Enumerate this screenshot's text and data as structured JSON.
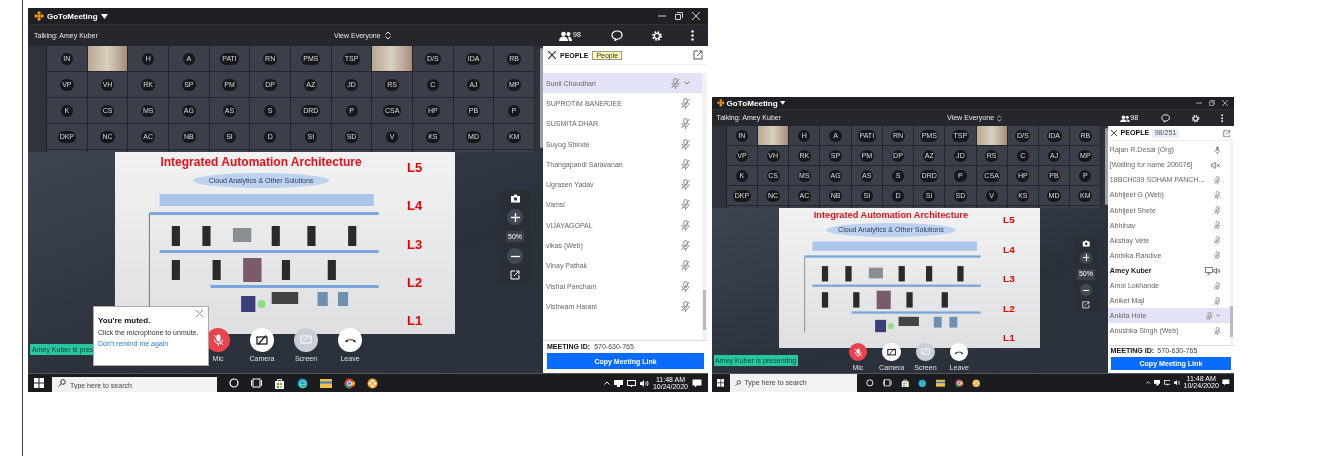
{
  "screenshots": [
    {
      "app_name": "GoToMeeting",
      "talking": "Talking: Amey Kuber",
      "view_selector": "View Everyone",
      "people_count": "98",
      "tiles": [
        {
          "kind": "initials",
          "text": "IN"
        },
        {
          "kind": "video"
        },
        {
          "kind": "initials",
          "text": "H"
        },
        {
          "kind": "initials",
          "text": "A"
        },
        {
          "kind": "initials",
          "text": "PATI"
        },
        {
          "kind": "initials",
          "text": "RN"
        },
        {
          "kind": "initials",
          "text": "PMS"
        },
        {
          "kind": "initials",
          "text": "TSP"
        },
        {
          "kind": "video"
        },
        {
          "kind": "initials",
          "text": "D/S"
        },
        {
          "kind": "initials",
          "text": "IDA"
        },
        {
          "kind": "initials",
          "text": "RB"
        },
        {
          "kind": "initials",
          "text": "VP"
        },
        {
          "kind": "initials",
          "text": "VH"
        },
        {
          "kind": "initials",
          "text": "RK"
        },
        {
          "kind": "initials",
          "text": "SP"
        },
        {
          "kind": "initials",
          "text": "PM"
        },
        {
          "kind": "initials",
          "text": "DP"
        },
        {
          "kind": "initials",
          "text": "AZ"
        },
        {
          "kind": "initials",
          "text": "JD"
        },
        {
          "kind": "initials",
          "text": "RS"
        },
        {
          "kind": "initials",
          "text": "C"
        },
        {
          "kind": "initials",
          "text": "AJ"
        },
        {
          "kind": "initials",
          "text": "MP"
        },
        {
          "kind": "initials",
          "text": "K"
        },
        {
          "kind": "initials",
          "text": "CS"
        },
        {
          "kind": "initials",
          "text": "MS"
        },
        {
          "kind": "initials",
          "text": "AG"
        },
        {
          "kind": "initials",
          "text": "AS"
        },
        {
          "kind": "initials",
          "text": "S"
        },
        {
          "kind": "initials",
          "text": "DRD"
        },
        {
          "kind": "initials",
          "text": "P"
        },
        {
          "kind": "initials",
          "text": "CSA"
        },
        {
          "kind": "initials",
          "text": "HP"
        },
        {
          "kind": "initials",
          "text": "PB"
        },
        {
          "kind": "initials",
          "text": "P"
        },
        {
          "kind": "initials",
          "text": "DKP"
        },
        {
          "kind": "initials",
          "text": "NC"
        },
        {
          "kind": "initials",
          "text": "AC"
        },
        {
          "kind": "initials",
          "text": "NB"
        },
        {
          "kind": "initials",
          "text": "SI"
        },
        {
          "kind": "initials",
          "text": "D"
        },
        {
          "kind": "initials",
          "text": "SI"
        },
        {
          "kind": "initials",
          "text": "SD"
        },
        {
          "kind": "initials",
          "text": "V"
        },
        {
          "kind": "initials",
          "text": "KS"
        },
        {
          "kind": "initials",
          "text": "MD"
        },
        {
          "kind": "initials",
          "text": "KM"
        }
      ],
      "slide": {
        "title": "Integrated Automation Architecture",
        "banner": "Cloud Analytics & Other Solutions",
        "levels": [
          "L5",
          "L4",
          "L3",
          "L2",
          "L1"
        ]
      },
      "zoom_level": "50%",
      "presenter_badge": "Amey Kuber is pres",
      "muted_popup": {
        "title": "You're muted.",
        "message": "Click the microphone to unmute.",
        "link": "Don't remind me again"
      },
      "controls": [
        {
          "kind": "mic",
          "label": "Mic",
          "disabled": false
        },
        {
          "kind": "camera",
          "label": "Camera",
          "disabled": false
        },
        {
          "kind": "screen",
          "label": "Screen",
          "disabled": true
        },
        {
          "kind": "leave",
          "label": "Leave",
          "disabled": false
        }
      ],
      "panel": {
        "title": "PEOPLE",
        "tooltip": "People"
      },
      "people": [
        {
          "name": "Sunil Choudhari",
          "kind": "mic_muted",
          "selected": true
        },
        {
          "name": "SUPROTIM BANERJEE",
          "kind": "mic_muted",
          "selected": false
        },
        {
          "name": "SUSMITA DHAR",
          "kind": "mic_muted",
          "selected": false
        },
        {
          "name": "Suyog Shinde",
          "kind": "mic_muted",
          "selected": false
        },
        {
          "name": "Thangapandi Saravanan",
          "kind": "mic_muted",
          "selected": false
        },
        {
          "name": "Ugrasen Yadav",
          "kind": "mic_muted",
          "selected": false
        },
        {
          "name": "Vamsi",
          "kind": "mic_muted",
          "selected": false
        },
        {
          "name": "VIJAYAGOPAL",
          "kind": "mic_muted",
          "selected": false
        },
        {
          "name": "vikas  (Web)",
          "kind": "mic_muted",
          "selected": false
        },
        {
          "name": "Vinay Pathak",
          "kind": "mic_muted",
          "selected": false
        },
        {
          "name": "Vishal Pancham",
          "kind": "mic_muted",
          "selected": false
        },
        {
          "name": "Vishwam Harani",
          "kind": "mic_muted",
          "selected": false
        }
      ],
      "meeting_id_label": "MEETING ID:",
      "meeting_id": "570-630-765",
      "copy_button": "Copy Meeting Link",
      "taskbar": {
        "search_placeholder": "Type here to search",
        "time": "11:48 AM",
        "date": "10/24/2020"
      }
    },
    {
      "app_name": "GoToMeeting",
      "talking": "Talking: Amey Kuber",
      "view_selector": "View Everyone",
      "people_count": "98",
      "tiles": [
        {
          "kind": "initials",
          "text": "IN"
        },
        {
          "kind": "video"
        },
        {
          "kind": "initials",
          "text": "H"
        },
        {
          "kind": "initials",
          "text": "A"
        },
        {
          "kind": "initials",
          "text": "PATI"
        },
        {
          "kind": "initials",
          "text": "RN"
        },
        {
          "kind": "initials",
          "text": "PMS"
        },
        {
          "kind": "initials",
          "text": "TSP"
        },
        {
          "kind": "video"
        },
        {
          "kind": "initials",
          "text": "D/S"
        },
        {
          "kind": "initials",
          "text": "IDA"
        },
        {
          "kind": "initials",
          "text": "RB"
        },
        {
          "kind": "initials",
          "text": "VP"
        },
        {
          "kind": "initials",
          "text": "VH"
        },
        {
          "kind": "initials",
          "text": "RK"
        },
        {
          "kind": "initials",
          "text": "SP"
        },
        {
          "kind": "initials",
          "text": "PM"
        },
        {
          "kind": "initials",
          "text": "DP"
        },
        {
          "kind": "initials",
          "text": "AZ"
        },
        {
          "kind": "initials",
          "text": "JD"
        },
        {
          "kind": "initials",
          "text": "RS"
        },
        {
          "kind": "initials",
          "text": "C"
        },
        {
          "kind": "initials",
          "text": "AJ"
        },
        {
          "kind": "initials",
          "text": "MP"
        },
        {
          "kind": "initials",
          "text": "K"
        },
        {
          "kind": "initials",
          "text": "CS"
        },
        {
          "kind": "initials",
          "text": "MS"
        },
        {
          "kind": "initials",
          "text": "AG"
        },
        {
          "kind": "initials",
          "text": "AS"
        },
        {
          "kind": "initials",
          "text": "S"
        },
        {
          "kind": "initials",
          "text": "DRD"
        },
        {
          "kind": "initials",
          "text": "P"
        },
        {
          "kind": "initials",
          "text": "CSA"
        },
        {
          "kind": "initials",
          "text": "HP"
        },
        {
          "kind": "initials",
          "text": "PB"
        },
        {
          "kind": "initials",
          "text": "P"
        },
        {
          "kind": "initials",
          "text": "DKP"
        },
        {
          "kind": "initials",
          "text": "NC"
        },
        {
          "kind": "initials",
          "text": "AC"
        },
        {
          "kind": "initials",
          "text": "NB"
        },
        {
          "kind": "initials",
          "text": "SI"
        },
        {
          "kind": "initials",
          "text": "D"
        },
        {
          "kind": "initials",
          "text": "SI"
        },
        {
          "kind": "initials",
          "text": "SD"
        },
        {
          "kind": "initials",
          "text": "V"
        },
        {
          "kind": "initials",
          "text": "KS"
        },
        {
          "kind": "initials",
          "text": "MD"
        },
        {
          "kind": "initials",
          "text": "KM"
        }
      ],
      "slide": {
        "title": "Integrated Automation Architecture",
        "banner": "Cloud Analytics & Other Solutions",
        "levels": [
          "L5",
          "L4",
          "L3",
          "L2",
          "L1"
        ]
      },
      "zoom_level": "50%",
      "presenter_badge": "Amey Kuber is presenting",
      "controls": [
        {
          "kind": "mic",
          "label": "Mic",
          "disabled": false
        },
        {
          "kind": "camera",
          "label": "Camera",
          "disabled": false
        },
        {
          "kind": "screen",
          "label": "Screen",
          "disabled": true
        },
        {
          "kind": "leave",
          "label": "Leave",
          "disabled": false
        }
      ],
      "panel": {
        "title": "PEOPLE",
        "count": "98/251"
      },
      "people": [
        {
          "name": "Rajan R.Desai  (Org)",
          "kind": "mic",
          "selected": false
        },
        {
          "name": "[Waiting for name 200076]",
          "kind": "speaker_muted",
          "selected": false
        },
        {
          "name": "18BCH039 SOHAM PANCH...",
          "kind": "mic_muted",
          "selected": false
        },
        {
          "name": "Abhijeet G  (Web)",
          "kind": "mic_muted",
          "selected": false
        },
        {
          "name": "Abhijeet Shete",
          "kind": "mic_muted",
          "selected": false
        },
        {
          "name": "Abhinav",
          "kind": "mic_muted",
          "selected": false
        },
        {
          "name": "Akshay Vete",
          "kind": "mic_muted",
          "selected": false
        },
        {
          "name": "Ambika Randive",
          "kind": "mic_muted",
          "selected": false
        },
        {
          "name": "Amey Kuber",
          "kind": "presenting",
          "selected": false
        },
        {
          "name": "Amol Lokhande",
          "kind": "mic_muted",
          "selected": false
        },
        {
          "name": "Aniket Maji",
          "kind": "mic_muted",
          "selected": false
        },
        {
          "name": "Ankita Hote",
          "kind": "mic_muted",
          "selected": true
        },
        {
          "name": "Anushka Singh  (Web)",
          "kind": "mic_muted",
          "selected": false
        }
      ],
      "meeting_id_label": "MEETING ID:",
      "meeting_id": "570-630-765",
      "copy_button": "Copy Meeting Link",
      "taskbar": {
        "search_placeholder": "Type here to search",
        "time": "11:48 AM",
        "date": "10/24/2020"
      }
    }
  ]
}
